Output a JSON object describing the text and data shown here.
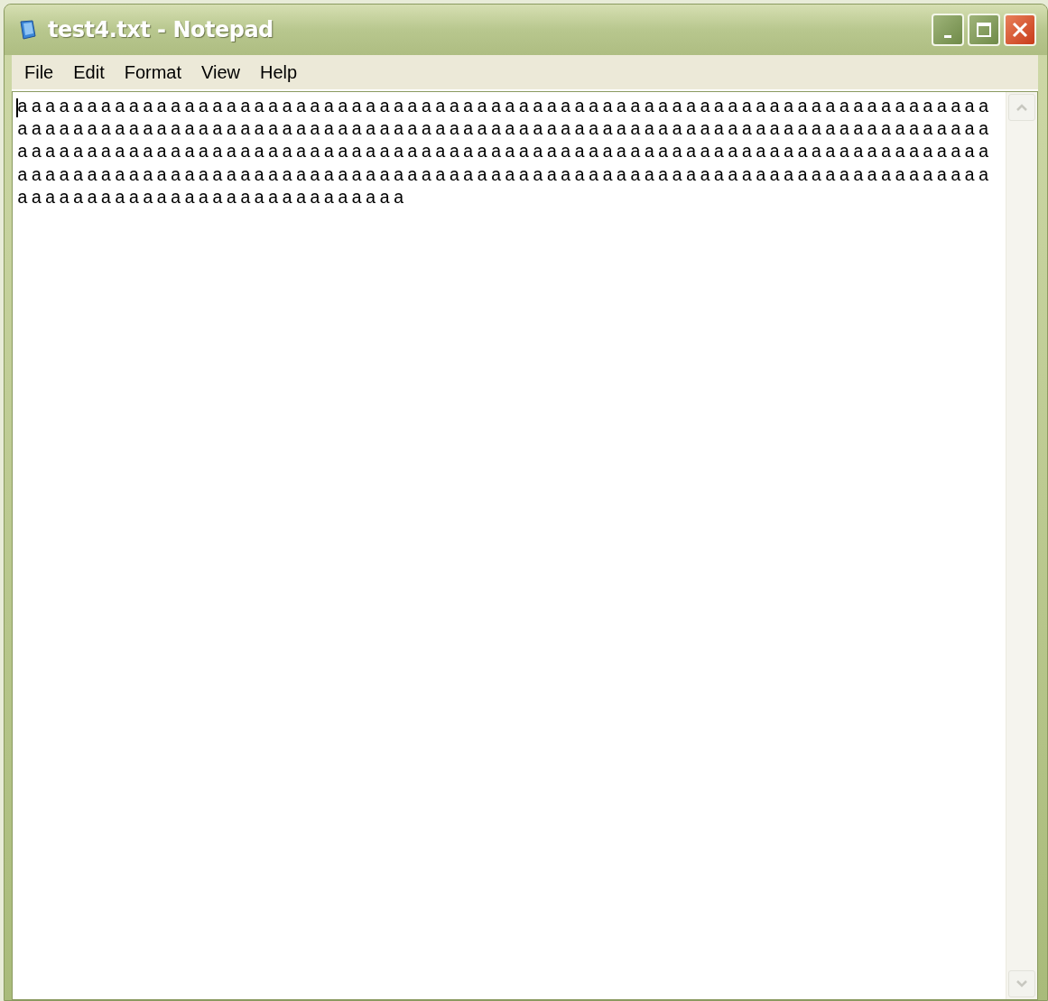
{
  "window": {
    "title": "test4.txt - Notepad"
  },
  "menu": [
    "File",
    "Edit",
    "Format",
    "View",
    "Help"
  ],
  "text_lines": [
    "aaaaaaaaaaaaaaaaaaaaaaaaaaaaaaaaaaaaaaaaaaaaaaaaaaaaaaaaaaaaaaaaaaaaaa",
    "aaaaaaaaaaaaaaaaaaaaaaaaaaaaaaaaaaaaaaaaaaaaaaaaaaaaaaaaaaaaaaaaaaaaaa",
    "aaaaaaaaaaaaaaaaaaaaaaaaaaaaaaaaaaaaaaaaaaaaaaaaaaaaaaaaaaaaaaaaaaaaaa",
    "aaaaaaaaaaaaaaaaaaaaaaaaaaaaaaaaaaaaaaaaaaaaaaaaaaaaaaaaaaaaaaaaaaaaaa",
    "aaaaaaaaaaaaaaaaaaaaaaaaaaaa"
  ]
}
